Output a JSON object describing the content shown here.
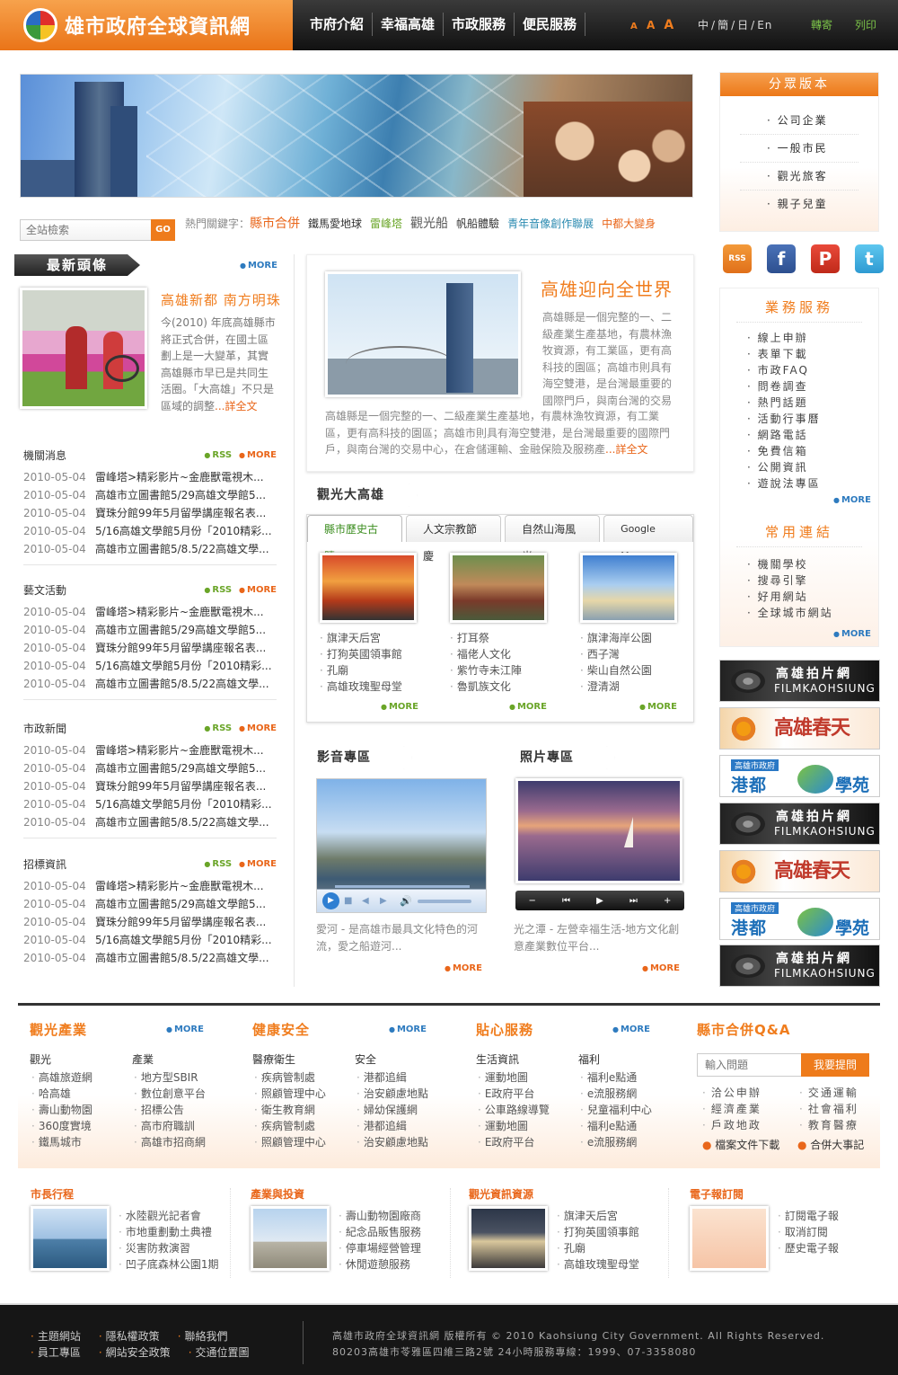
{
  "header": {
    "site_title": "雄市政府全球資訊網",
    "nav": [
      "市府介紹",
      "幸福高雄",
      "市政服務",
      "便民服務"
    ],
    "font_sizes": [
      "A",
      "A",
      "A"
    ],
    "languages": [
      "中",
      "簡",
      "日",
      "En"
    ],
    "forward": "轉寄",
    "print": "列印"
  },
  "search": {
    "placeholder": "全站檢索",
    "button": "GO"
  },
  "hot_keywords": {
    "label": "熱門關鍵字：",
    "items": [
      "縣市合併",
      "鐵馬愛地球",
      "雷峰塔",
      "觀光船",
      "帆船體驗",
      "青年音像創作聯展",
      "中都大變身"
    ]
  },
  "left": {
    "headline_title": "最新頭條",
    "more": "MORE",
    "lead_title": "高雄新都 南方明珠",
    "lead_text": "今(2010) 年底高雄縣市將正式合併，在國土區劃上是一大變革，其實高雄縣市早已是共同生活圈。「大高雄」不只是區域的調整",
    "lead_more": "...詳全文",
    "rss": "RSS",
    "sections": [
      {
        "title": "機關消息",
        "rows": [
          {
            "date": "2010-05-04",
            "text": "雷峰塔>精彩影片~金鹿獸電視木..."
          },
          {
            "date": "2010-05-04",
            "text": "高雄市立圖書館5/29高雄文學館5..."
          },
          {
            "date": "2010-05-04",
            "text": "寶珠分館99年5月留學講座報名表..."
          },
          {
            "date": "2010-05-04",
            "text": "5/16高雄文學館5月份「2010精彩..."
          },
          {
            "date": "2010-05-04",
            "text": "高雄市立圖書館5/8.5/22高雄文學..."
          }
        ]
      },
      {
        "title": "藝文活動",
        "rows": [
          {
            "date": "2010-05-04",
            "text": "雷峰塔>精彩影片~金鹿獸電視木..."
          },
          {
            "date": "2010-05-04",
            "text": "高雄市立圖書館5/29高雄文學館5..."
          },
          {
            "date": "2010-05-04",
            "text": "寶珠分館99年5月留學講座報名表..."
          },
          {
            "date": "2010-05-04",
            "text": "5/16高雄文學館5月份「2010精彩..."
          },
          {
            "date": "2010-05-04",
            "text": "高雄市立圖書館5/8.5/22高雄文學..."
          }
        ]
      },
      {
        "title": "市政新聞",
        "rows": [
          {
            "date": "2010-05-04",
            "text": "雷峰塔>精彩影片~金鹿獸電視木..."
          },
          {
            "date": "2010-05-04",
            "text": "高雄市立圖書館5/29高雄文學館5..."
          },
          {
            "date": "2010-05-04",
            "text": "寶珠分館99年5月留學講座報名表..."
          },
          {
            "date": "2010-05-04",
            "text": "5/16高雄文學館5月份「2010精彩..."
          },
          {
            "date": "2010-05-04",
            "text": "高雄市立圖書館5/8.5/22高雄文學..."
          }
        ]
      },
      {
        "title": "招標資訊",
        "rows": [
          {
            "date": "2010-05-04",
            "text": "雷峰塔>精彩影片~金鹿獸電視木..."
          },
          {
            "date": "2010-05-04",
            "text": "高雄市立圖書館5/29高雄文學館5..."
          },
          {
            "date": "2010-05-04",
            "text": "寶珠分館99年5月留學講座報名表..."
          },
          {
            "date": "2010-05-04",
            "text": "5/16高雄文學館5月份「2010精彩..."
          },
          {
            "date": "2010-05-04",
            "text": "高雄市立圖書館5/8.5/22高雄文學..."
          }
        ]
      }
    ]
  },
  "feature": {
    "title": "高雄迎向全世界",
    "text1": "高雄縣是一個完整的一、二級產業生產基地，有農林漁牧資源，有工業區，更有高科技的園區；高雄市則具有海空雙港，是台灣最重要的國際門戶，與南台灣的交易",
    "text2": "高雄縣是一個完整的一、二級產業生產基地，有農林漁牧資源，有工業區，更有高科技的園區；高雄市則具有海空雙港，是台灣最重要的國際門戶，與南台灣的交易中心，在倉儲運輸、金融保險及服務產",
    "more": "...詳全文"
  },
  "tourism": {
    "title": "觀光大高雄",
    "tabs": [
      "縣市歷史古蹟",
      "人文宗教節慶",
      "自然山海風光",
      "Google Map"
    ],
    "cols": [
      [
        "旗津天后宮",
        "打狗英國領事館",
        "孔廟",
        "高雄玫瑰聖母堂"
      ],
      [
        "打耳祭",
        "福佬人文化",
        "紫竹寺未江陣",
        "魯凱族文化"
      ],
      [
        "旗津海岸公園",
        "西子灣",
        "柴山自然公園",
        "澄清湖"
      ]
    ],
    "more": "MORE"
  },
  "media": {
    "video_title": "影音專區",
    "photo_title": "照片專區",
    "video_text": "愛河 - 是高雄市最具文化特色的河流，愛之船遊河...",
    "photo_text": "光之潭 - 左營幸福生活-地方文化創意產業數位平台...",
    "more": "MORE",
    "photo_controls": [
      "−",
      "⏮",
      "▶",
      "⏭",
      "+"
    ]
  },
  "right": {
    "groups_title": "分眾版本",
    "groups": [
      "公司企業",
      "一般市民",
      "觀光旅客",
      "親子兒童"
    ],
    "social": [
      "RSS",
      "f",
      "P",
      "t"
    ],
    "services_title": "業務服務",
    "services": [
      "線上申辦",
      "表單下載",
      "市政FAQ",
      "問卷調查",
      "熱門話題",
      "活動行事曆",
      "網路電話",
      "免費信箱",
      "公開資訊",
      "遊說法專區"
    ],
    "links_title": "常用連結",
    "links": [
      "機關學校",
      "搜尋引擎",
      "好用網站",
      "全球城市網站"
    ],
    "more": "MORE",
    "banners": [
      {
        "type": "film",
        "line1": "高雄拍片網",
        "line2": "FILMKAOHSIUNG"
      },
      {
        "type": "spring",
        "line1": "高雄春天"
      },
      {
        "type": "school",
        "line0": "高雄市政府",
        "line1": "港都",
        "line2": "學苑"
      },
      {
        "type": "film",
        "line1": "高雄拍片網",
        "line2": "FILMKAOHSIUNG"
      },
      {
        "type": "spring",
        "line1": "高雄春天"
      },
      {
        "type": "school",
        "line0": "高雄市政府",
        "line1": "港都",
        "line2": "學苑"
      },
      {
        "type": "film",
        "line1": "高雄拍片網",
        "line2": "FILMKAOHSIUNG"
      }
    ]
  },
  "panel": {
    "more": "MORE",
    "sections": [
      {
        "title": "觀光產業",
        "cols": [
          {
            "sub": "觀光",
            "items": [
              "高雄旅遊網",
              "哈高雄",
              "壽山動物園",
              "360度實境",
              "鐵馬城市"
            ]
          },
          {
            "sub": "產業",
            "items": [
              "地方型SBIR",
              "數位創意平台",
              "招標公告",
              "高市府職訓",
              "高雄市招商網"
            ]
          }
        ]
      },
      {
        "title": "健康安全",
        "cols": [
          {
            "sub": "醫療衛生",
            "items": [
              "疾病管制處",
              "照顧管理中心",
              "衛生教育網",
              "疾病管制處",
              "照顧管理中心"
            ]
          },
          {
            "sub": "安全",
            "items": [
              "港都追緝",
              "治安顧慮地點",
              "婦幼保護網",
              "港都追緝",
              "治安顧慮地點"
            ]
          }
        ]
      },
      {
        "title": "貼心服務",
        "cols": [
          {
            "sub": "生活資訊",
            "items": [
              "運動地圖",
              "E政府平台",
              "公車路線導覽",
              "運動地圖",
              "E政府平台"
            ]
          },
          {
            "sub": "福利",
            "items": [
              "福利e點通",
              "e流服務網",
              "兒童福利中心",
              "福利e點通",
              "e流服務網"
            ]
          }
        ]
      }
    ],
    "qa": {
      "title": "縣市合併Q&A",
      "placeholder": "輸入問題",
      "button": "我要提問",
      "col1": [
        "洽公申辦",
        "經濟產業",
        "戶政地政"
      ],
      "col2": [
        "交通運輸",
        "社會福利",
        "教育醫療"
      ],
      "link1": "檔案文件下載",
      "link2": "合併大事記"
    }
  },
  "bottom": [
    {
      "title": "市長行程",
      "items": [
        "水陸觀光記者會",
        "市地重劃動土典禮",
        "災害防救演習",
        "凹子底森林公園1期"
      ]
    },
    {
      "title": "產業與投資",
      "items": [
        "壽山動物園廠商",
        "紀念品販售服務",
        "停車場經營管理",
        "休閒遊憩服務"
      ]
    },
    {
      "title": "觀光資訊資源",
      "items": [
        "旗津天后宮",
        "打狗英國領事館",
        "孔廟",
        "高雄玫瑰聖母堂"
      ]
    },
    {
      "title": "電子報訂閱",
      "items": [
        "訂閱電子報",
        "取消訂閱",
        "歷史電子報"
      ]
    }
  ],
  "footer": {
    "links": [
      [
        "主題網站",
        "隱私權政策",
        "聯絡我們"
      ],
      [
        "員工專區",
        "網站安全政策",
        "交通位置圖"
      ]
    ],
    "copyright": "高雄市政府全球資訊網 版權所有 © 2010 Kaohsiung City Government. All Rights Reserved.",
    "address": "80203高雄市苓雅區四維三路2號 24小時服務專線：1999、07-3358080"
  }
}
